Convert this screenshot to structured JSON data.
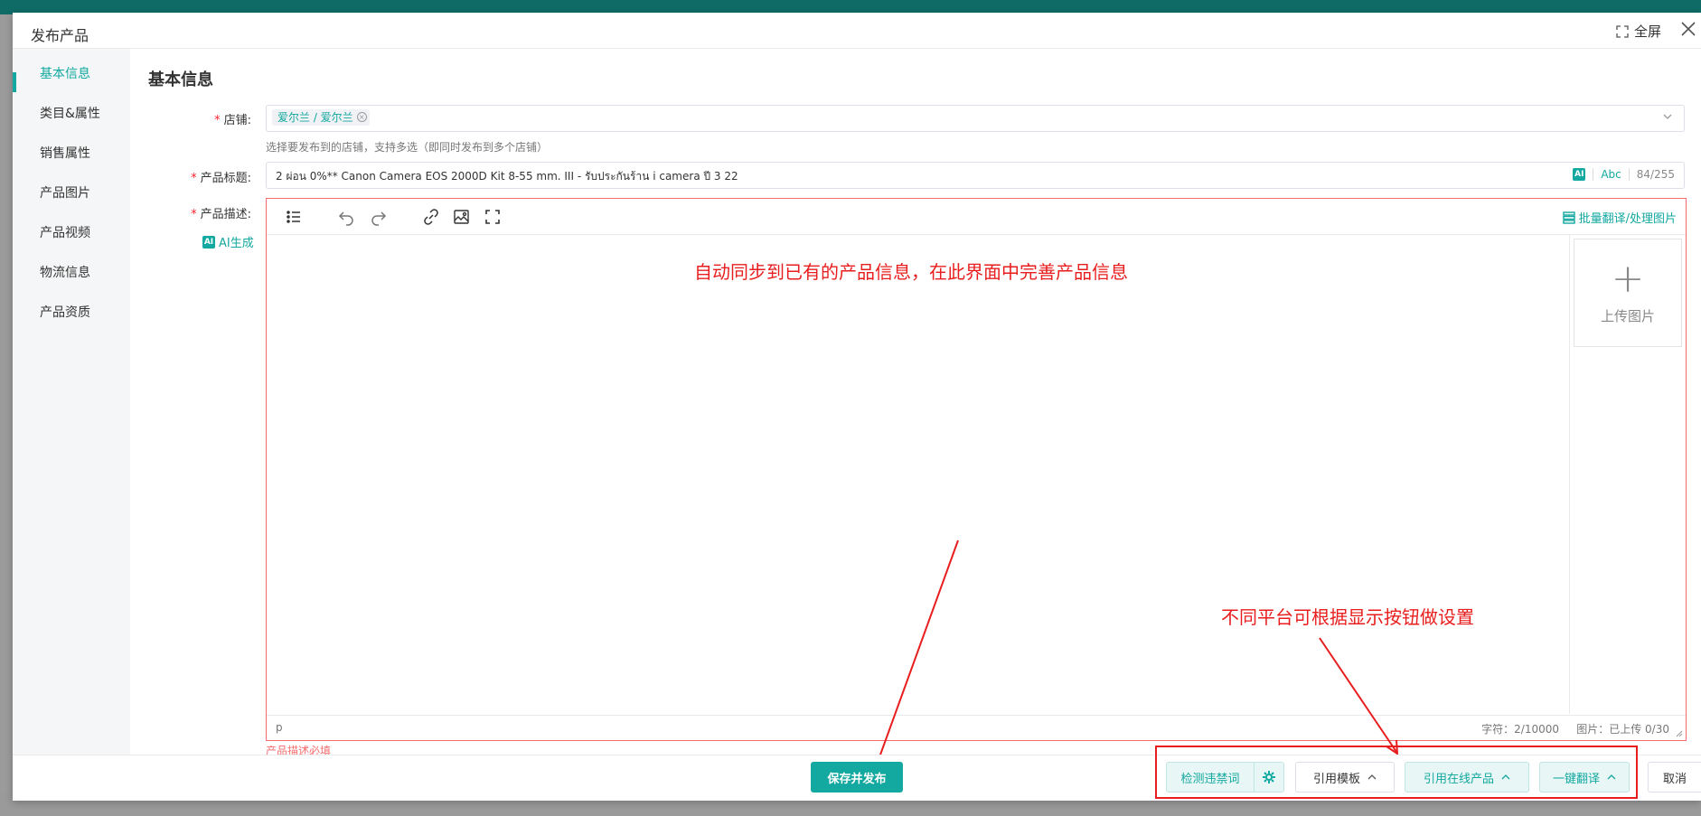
{
  "modal": {
    "title": "发布产品",
    "fullscreen_label": "全屏"
  },
  "sidebar": {
    "items": [
      {
        "label": "基本信息",
        "active": true
      },
      {
        "label": "类目&属性"
      },
      {
        "label": "销售属性"
      },
      {
        "label": "产品图片"
      },
      {
        "label": "产品视频"
      },
      {
        "label": "物流信息"
      },
      {
        "label": "产品资质"
      }
    ]
  },
  "section": {
    "title": "基本信息"
  },
  "form": {
    "shop": {
      "label": "店铺:",
      "tag": "爱尔兰 / 爱尔兰",
      "hint": "选择要发布到的店铺，支持多选（即同时发布到多个店铺）"
    },
    "title": {
      "label": "产品标题:",
      "value": "2 ผ่อน 0%** Canon Camera EOS 2000D Kit 8-55 mm. III - รับประกันร้าน i camera ปี 3 22",
      "ai_badge": "AI",
      "abc_label": "Abc",
      "count": "84/255"
    },
    "description": {
      "label": "产品描述:",
      "ai_generate": "AI生成",
      "batch_label": "批量翻译/处理图片",
      "upload_label": "上传图片",
      "upload_plus": "+",
      "footer_tag": "p",
      "char_count": "字符：2/10000",
      "image_count": "图片：已上传 0/30",
      "error": "产品描述必填"
    }
  },
  "annotations": {
    "center": "自动同步到已有的产品信息，在此界面中完善产品信息",
    "bottom": "不同平台可根据显示按钮做设置"
  },
  "footer": {
    "save_publish": "保存并发布",
    "check_words": "检测违禁词",
    "use_template": "引用模板",
    "use_online_product": "引用在线产品",
    "one_click_translate": "一键翻译",
    "cancel": "取消"
  },
  "colors": {
    "accent": "#13a8a0",
    "error": "#f56c6c",
    "annotation": "#e81e1e"
  }
}
